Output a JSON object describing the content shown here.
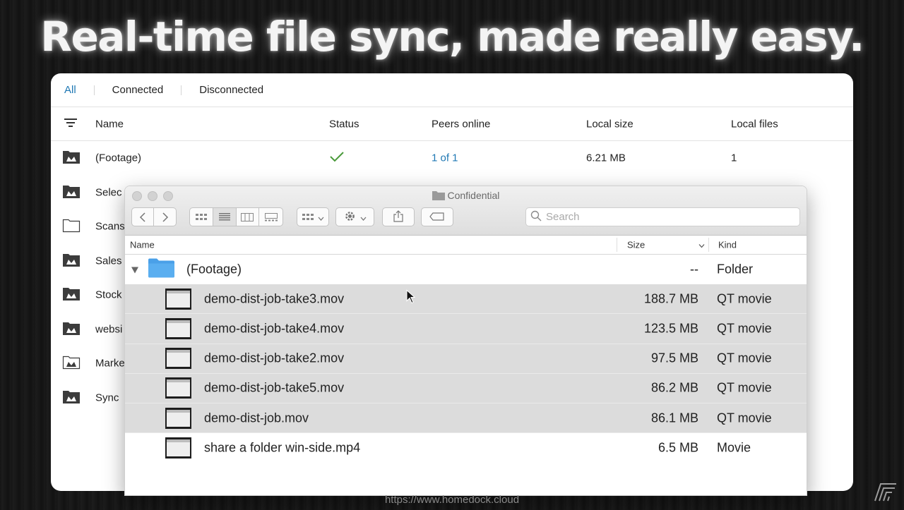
{
  "headline": "Real-time file sync, made really easy.",
  "tabs": [
    {
      "label": "All",
      "active": true
    },
    {
      "label": "Connected",
      "active": false
    },
    {
      "label": "Disconnected",
      "active": false
    }
  ],
  "table": {
    "columns": {
      "name": "Name",
      "status": "Status",
      "peers": "Peers online",
      "local_size": "Local size",
      "local_files": "Local files"
    },
    "rows": [
      {
        "name": "(Footage)",
        "icon": "shared-folder-icon",
        "status_icon": "checkmark-icon",
        "peers": "1 of 1",
        "local_size": "6.21 MB",
        "local_files": "1"
      },
      {
        "name": "Selec",
        "icon": "shared-folder-icon"
      },
      {
        "name": "Scans",
        "icon": "folder-outline-icon"
      },
      {
        "name": "Sales",
        "icon": "shared-folder-icon"
      },
      {
        "name": "Stock",
        "icon": "shared-folder-icon"
      },
      {
        "name": "websi",
        "icon": "shared-folder-icon"
      },
      {
        "name": "Marke",
        "icon": "shared-folder-outline-icon"
      },
      {
        "name": "Sync",
        "icon": "shared-folder-icon"
      }
    ]
  },
  "finder": {
    "title": "Confidential",
    "search_placeholder": "Search",
    "columns": {
      "name": "Name",
      "size": "Size",
      "kind": "Kind"
    },
    "folder": {
      "name": "(Footage)",
      "size": "--",
      "kind": "Folder"
    },
    "files": [
      {
        "name": "demo-dist-job-take3.mov",
        "size": "188.7 MB",
        "kind": "QT movie",
        "selected": true
      },
      {
        "name": "demo-dist-job-take4.mov",
        "size": "123.5 MB",
        "kind": "QT movie",
        "selected": true
      },
      {
        "name": "demo-dist-job-take2.mov",
        "size": "97.5 MB",
        "kind": "QT movie",
        "selected": true
      },
      {
        "name": "demo-dist-job-take5.mov",
        "size": "86.2 MB",
        "kind": "QT movie",
        "selected": true
      },
      {
        "name": "demo-dist-job.mov",
        "size": "86.1 MB",
        "kind": "QT movie",
        "selected": true
      },
      {
        "name": "share a folder win-side.mp4",
        "size": "6.5 MB",
        "kind": "Movie",
        "selected": false
      }
    ]
  },
  "footer_url": "https://www.homedock.cloud",
  "colors": {
    "accent": "#1f78b4",
    "status_ok": "#4a9a3a",
    "selection": "#dcdcdc",
    "folder_blue": "#5aaef0"
  }
}
